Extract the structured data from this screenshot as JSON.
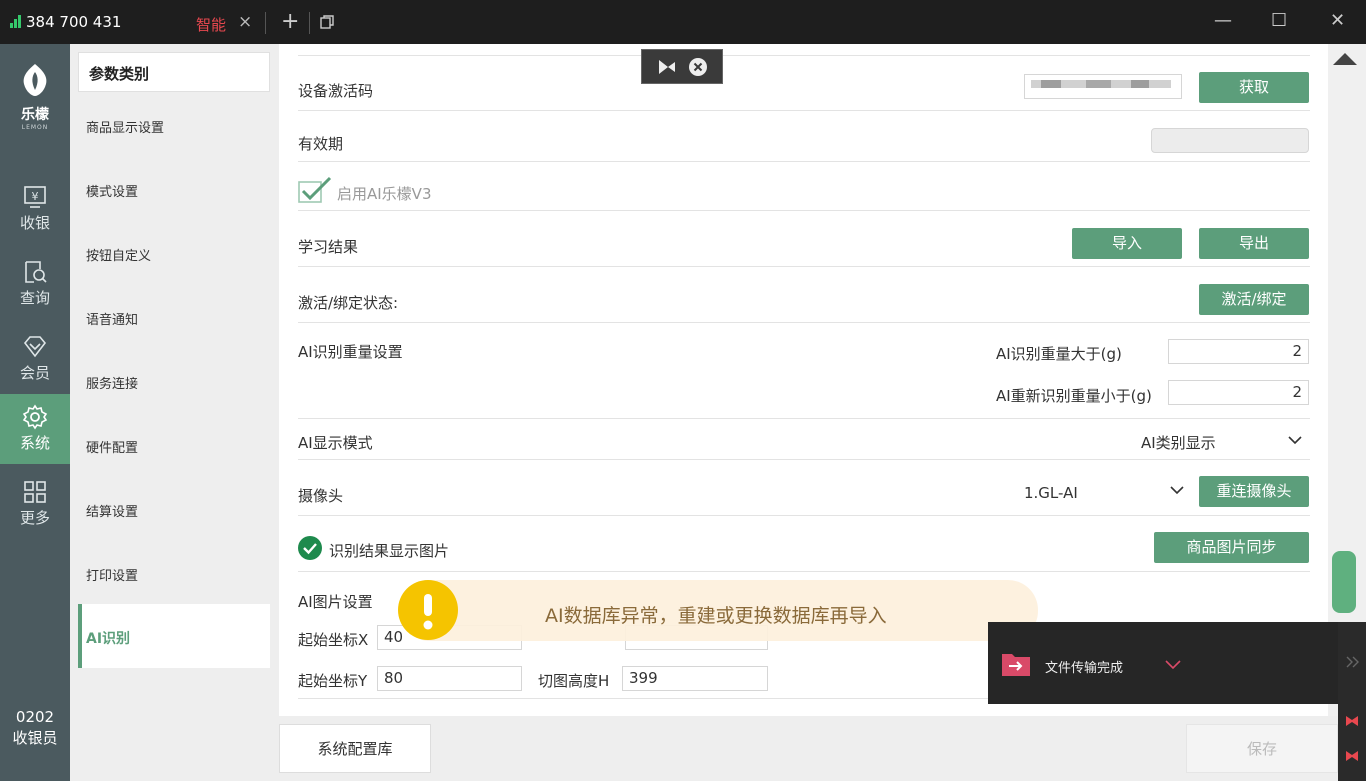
{
  "titlebar": {
    "phone": "384 700 431",
    "tab_label": "智能",
    "tab_close": "×",
    "plus": "+",
    "minimize": "—",
    "maximize": "☐",
    "close": "✕"
  },
  "brand": {
    "name": "乐檬",
    "sub": "LEMON"
  },
  "nav": [
    {
      "label": "收银",
      "icon": "cashier-icon"
    },
    {
      "label": "查询",
      "icon": "query-icon"
    },
    {
      "label": "会员",
      "icon": "member-icon"
    },
    {
      "label": "系统",
      "icon": "gear-icon"
    },
    {
      "label": "更多",
      "icon": "grid-icon"
    }
  ],
  "cashier": {
    "id": "0202",
    "role": "收银员"
  },
  "categories": {
    "header": "参数类别",
    "items": [
      "商品显示设置",
      "模式设置",
      "按钮自定义",
      "语音通知",
      "服务连接",
      "硬件配置",
      "结算设置",
      "打印设置"
    ],
    "active": "AI识别"
  },
  "settings": {
    "activation_code_label": "设备激活码",
    "get_button": "获取",
    "validity_label": "有效期",
    "enable_ai_label": "启用AI乐檬V3",
    "learning_result_label": "学习结果",
    "import_button": "导入",
    "export_button": "导出",
    "bind_status_label": "激活/绑定状态:",
    "activate_button": "激活/绑定",
    "weight_setting_label": "AI识别重量设置",
    "weight_greater_label": "AI识别重量大于(g)",
    "weight_greater_value": "2",
    "reweigh_less_label": "AI重新识别重量小于(g)",
    "reweigh_less_value": "2",
    "display_mode_label": "AI显示模式",
    "display_mode_value": "AI类别显示",
    "camera_label": "摄像头",
    "camera_value": "1.GL-AI",
    "reconnect_button": "重连摄像头",
    "show_image_label": "识别结果显示图片",
    "sync_images_button": "商品图片同步",
    "image_setting_label": "AI图片设置",
    "start_x_label": "起始坐标X",
    "start_x_value": "40",
    "start_y_label": "起始坐标Y",
    "start_y_value": "80",
    "crop_height_label": "切图高度H",
    "crop_height_value": "399"
  },
  "toast": {
    "message": "AI数据库异常，重建或更换数据库再导入"
  },
  "notify": {
    "message": "文件传输完成"
  },
  "footer": {
    "config_button": "系统配置库",
    "save_button": "保存"
  },
  "colors": {
    "accent": "#5c9e7b",
    "nav_bg": "#4b5a5f",
    "warning": "#f5c400",
    "error": "#e8484f"
  }
}
